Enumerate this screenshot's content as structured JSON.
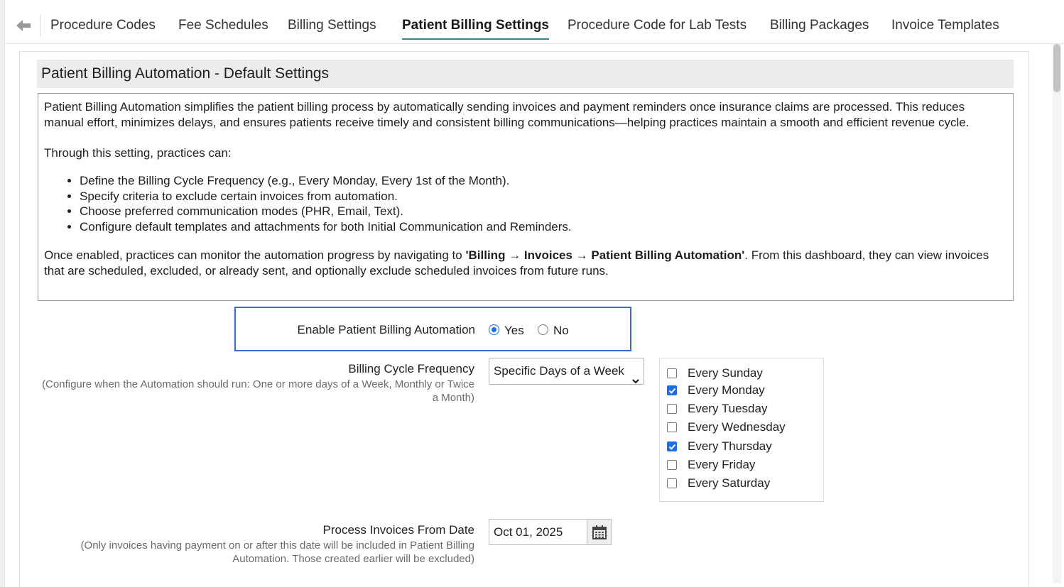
{
  "tabs": [
    {
      "label": "Procedure Codes",
      "active": false
    },
    {
      "label": "Fee Schedules",
      "active": false
    },
    {
      "label": "Billing Settings",
      "active": false
    },
    {
      "label": "Patient Billing Settings",
      "active": true
    },
    {
      "label": "Procedure Code for Lab Tests",
      "active": false
    },
    {
      "label": "Billing Packages",
      "active": false
    },
    {
      "label": "Invoice Templates",
      "active": false
    }
  ],
  "section": {
    "title": "Patient Billing Automation - Default Settings"
  },
  "description": {
    "intro": "Patient Billing Automation simplifies the patient billing process by automatically sending invoices and payment reminders once insurance claims are processed. This reduces manual effort, minimizes delays, and ensures patients receive timely and consistent billing communications—helping practices maintain a smooth and efficient revenue cycle.",
    "lead": "Through this setting, practices can:",
    "bullets": [
      "Define the Billing Cycle Frequency (e.g., Every Monday, Every 1st of the Month).",
      "Specify criteria to exclude certain invoices from automation.",
      "Choose preferred communication modes (PHR, Email, Text).",
      "Configure default templates and attachments for both Initial Communication and Reminders."
    ],
    "outro_before": "Once enabled, practices can monitor the automation progress by navigating to ",
    "outro_path": "'Billing → Invoices → Patient Billing Automation'",
    "outro_after": ". From this dashboard, they can view invoices that are scheduled, excluded, or already sent, and optionally exclude scheduled invoices from future runs."
  },
  "enable": {
    "label": "Enable Patient Billing Automation",
    "yes_label": "Yes",
    "no_label": "No",
    "selected": "Yes"
  },
  "billing_cycle": {
    "label": "Billing Cycle Frequency",
    "hint": "(Configure when the Automation should run: One or more days of a Week, Monthly or Twice a Month)",
    "selected": "Specific Days of a Week",
    "days": [
      {
        "label": "Every Sunday",
        "checked": false
      },
      {
        "label": "Every Monday",
        "checked": true
      },
      {
        "label": "Every Tuesday",
        "checked": false
      },
      {
        "label": "Every Wednesday",
        "checked": false
      },
      {
        "label": "Every Thursday",
        "checked": true
      },
      {
        "label": "Every Friday",
        "checked": false
      },
      {
        "label": "Every Saturday",
        "checked": false
      }
    ]
  },
  "process_from": {
    "label": "Process Invoices From Date",
    "hint": "(Only invoices having payment on or after this date will be included in Patient Billing Automation. Those created earlier will be excluded)",
    "value": "Oct 01, 2025"
  },
  "colors": {
    "active_tab_underline": "#2a8f8a",
    "focus_border": "#2f6fd1",
    "checkbox_checked": "#1d6fe0"
  }
}
